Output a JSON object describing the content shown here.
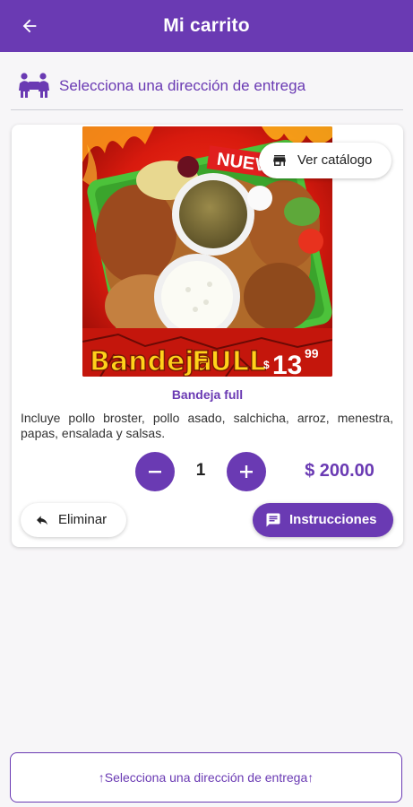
{
  "header": {
    "title": "Mi carrito",
    "back_icon": "arrow-back-icon"
  },
  "address": {
    "icon": "delivery-people-icon",
    "prompt": "Selecciona una dirección de entrega"
  },
  "cart_item": {
    "catalog_button_label": "Ver catálogo",
    "catalog_icon": "store-icon",
    "image": {
      "banner_text": "NUEVO",
      "brand_word1": "Bandeja",
      "brand_word2": "FULL",
      "promo_currency": "$",
      "promo_price_main": "13",
      "promo_price_cents": "99"
    },
    "name": "Bandeja full",
    "description": "Incluye pollo broster, pollo asado, salchicha, arroz, menestra, papas, ensalada y salsas.",
    "quantity": "1",
    "price": "$ 200.00",
    "delete_label": "Eliminar",
    "delete_icon": "reply-icon",
    "instructions_label": "Instrucciones",
    "instructions_icon": "message-icon"
  },
  "footer": {
    "select_address_label": "↑Selecciona una dirección de entrega↑"
  },
  "colors": {
    "primary": "#6a3ab3",
    "background": "#f7f6f8",
    "card": "#ffffff"
  }
}
